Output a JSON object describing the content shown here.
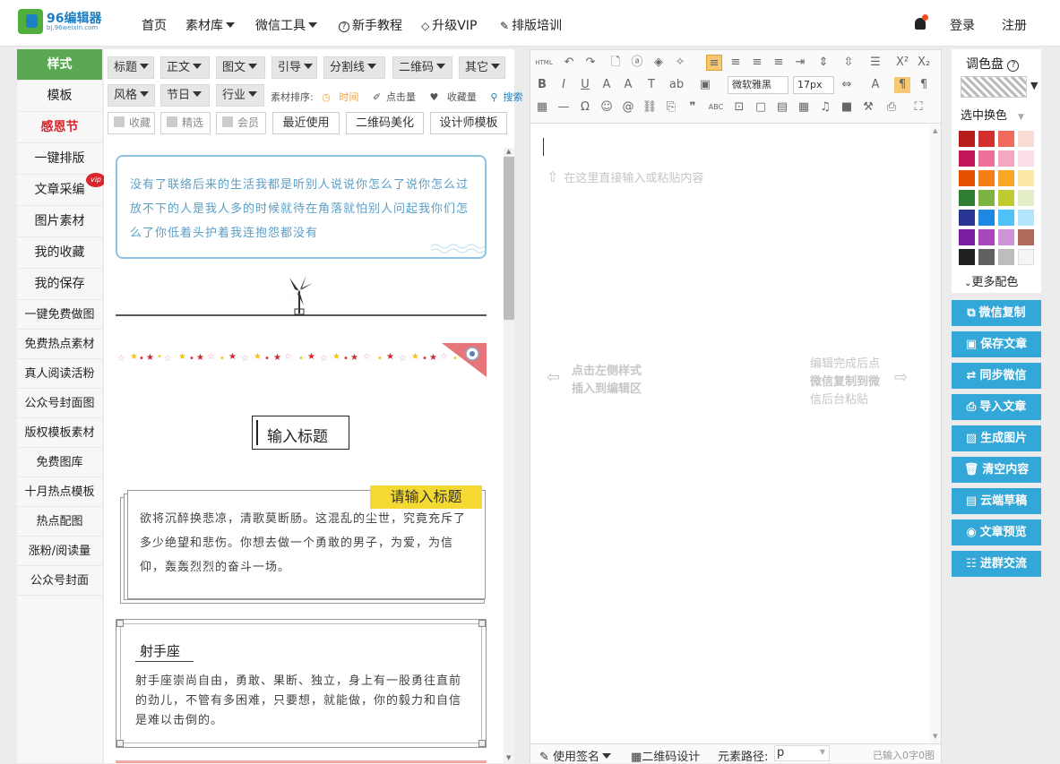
{
  "logo": {
    "brand": "96编辑器",
    "url_text": "bj.96weixin.com"
  },
  "nav": {
    "home": "首页",
    "materials": "素材库",
    "wechat_tools": "微信工具",
    "tutorial": "新手教程",
    "upgrade": "升级VIP",
    "training": "排版培训",
    "login": "登录",
    "register": "注册"
  },
  "left_menu": [
    "样式",
    "模板",
    "感恩节",
    "一键排版",
    "文章采编",
    "图片素材",
    "我的收藏",
    "我的保存",
    "一键免费做图",
    "免费热点素材",
    "真人阅读活粉",
    "公众号封面图",
    "版权模板素材",
    "免费图库",
    "十月热点模板",
    "热点配图",
    "涨粉/阅读量",
    "公众号封面"
  ],
  "vip_badge": "vip",
  "filter_tabs_row1": [
    "标题",
    "正文",
    "图文",
    "引导",
    "分割线",
    "二维码",
    "其它"
  ],
  "filter_tabs_row2": [
    "风格",
    "节日",
    "行业"
  ],
  "sort": {
    "label": "素材排序:",
    "time": "时间",
    "clicks": "点击量",
    "favorites": "收藏量",
    "search": "搜索"
  },
  "checkboxes": [
    "收藏",
    "精选",
    "会员"
  ],
  "buttons": {
    "recent": "最近使用",
    "qr_beautify": "二维码美化",
    "designer": "设计师模板"
  },
  "samples": {
    "card1": "没有了联络后来的生活我都是听别人说说你怎么了说你怎么过放不下的人是我人多的时候就待在角落就怕别人问起我你们怎么了你低着头护着我连抱怨都没有",
    "title_input": "输入标题",
    "please_title": "请输入标题",
    "para1": "欲将沉醉换悲凉，清歌莫断肠。这混乱的尘世，究竟充斥了多少绝望和悲伤。你想去做一个勇敢的男子，为爱，为信仰，轰轰烈烈的奋斗一场。",
    "sagittarius_title": "射手座",
    "sagittarius_text": "射手座崇尚自由，勇敢、果断、独立，身上有一股勇往直前的劲儿，不管有多困难，只要想，就能做，你的毅力和自信是难以击倒的。"
  },
  "editor": {
    "font_name": "微软雅黑",
    "font_size": "17px",
    "html_label": "HTML",
    "placeholder": "在这里直接输入或粘贴内容",
    "hint_left_line1": "点击左侧样式",
    "hint_left_line2": "插入到编辑区",
    "hint_right_line1": "编辑完成后点",
    "hint_right_line2": "微信复制到微",
    "hint_right_line3": "信后台粘贴",
    "status_signature": "使用签名",
    "status_qr": "二维码设计",
    "status_path_label": "元素路径:",
    "status_path_value": "p",
    "status_count": "已输入0字0图"
  },
  "palette": {
    "title": "调色盘",
    "select_change": "选中换色",
    "more": "更多配色",
    "colors": [
      "#b71c1c",
      "#d32f2f",
      "#ef6a5c",
      "#f9dcd6",
      "#c2185b",
      "#ec6f9c",
      "#f4a6c2",
      "#fbdfe8",
      "#e65100",
      "#f57f17",
      "#f9a825",
      "#fbe7a6",
      "#2e7d32",
      "#7cb342",
      "#c0ca33",
      "#e3edc8",
      "#283593",
      "#1e88e5",
      "#4fc3f7",
      "#b3e5fc",
      "#7b1fa2",
      "#ab47bc",
      "#ce93d8",
      "#b06a58",
      "#212121",
      "#616161",
      "#bdbdbd",
      "#f5f5f5"
    ]
  },
  "right_buttons": [
    "微信复制",
    "保存文章",
    "同步微信",
    "导入文章",
    "生成图片",
    "清空内容",
    "云端草稿",
    "文章预览",
    "进群交流"
  ]
}
